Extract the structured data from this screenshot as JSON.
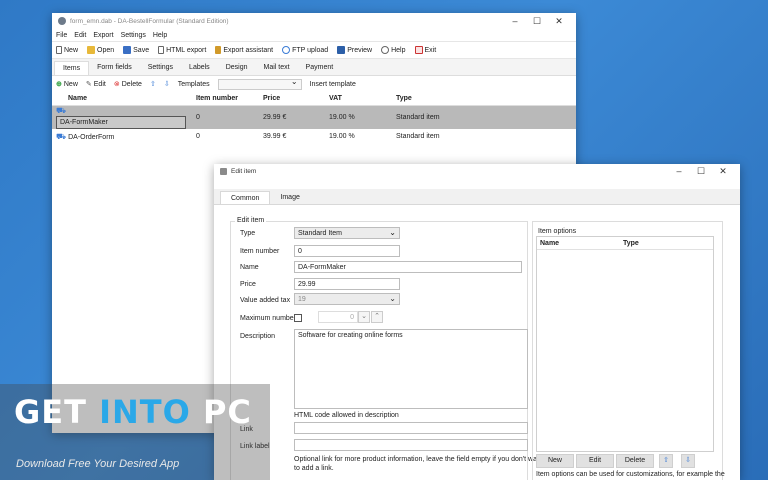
{
  "colors": {
    "accent": "#3a7bd5",
    "selected_row": "#b9b9b9",
    "desktop": "#2f79c6"
  },
  "main": {
    "title": "form_emn.dab - DA-BestellFormular (Standard Edition)",
    "menu": [
      "File",
      "Edit",
      "Export",
      "Settings",
      "Help"
    ],
    "toolbar": [
      {
        "label": "New",
        "icon": "new-file-icon"
      },
      {
        "label": "Open",
        "icon": "open-folder-icon"
      },
      {
        "label": "Save",
        "icon": "save-icon"
      },
      {
        "label": "HTML export",
        "icon": "html-export-icon"
      },
      {
        "label": "Export assistant",
        "icon": "wand-icon"
      },
      {
        "label": "FTP upload",
        "icon": "ftp-upload-icon"
      },
      {
        "label": "Preview",
        "icon": "preview-icon"
      },
      {
        "label": "Help",
        "icon": "help-icon"
      },
      {
        "label": "Exit",
        "icon": "exit-icon"
      }
    ],
    "tabs": [
      "Items",
      "Form fields",
      "Settings",
      "Labels",
      "Design",
      "Mail text",
      "Payment"
    ],
    "subbar": {
      "new": "New",
      "edit": "Edit",
      "delete": "Delete",
      "templates": "Templates",
      "insert": "Insert template"
    },
    "columns": [
      "Name",
      "Item number",
      "Price",
      "VAT",
      "Type"
    ],
    "rows": [
      {
        "name": "DA-FormMaker",
        "number": "0",
        "price": "29.99 €",
        "vat": "19.00 %",
        "type": "Standard item"
      },
      {
        "name": "DA-OrderForm",
        "number": "0",
        "price": "39.99 €",
        "vat": "19.00 %",
        "type": "Standard item"
      }
    ]
  },
  "dialog": {
    "title": "Edit item",
    "tabs": [
      "Common",
      "Image"
    ],
    "group_title": "Edit item",
    "labels": {
      "type": "Type",
      "item_number": "Item number",
      "name": "Name",
      "price": "Price",
      "vat": "Value added tax",
      "max_number": "Maximum number",
      "description": "Description",
      "link": "Link",
      "link_label": "Link label"
    },
    "values": {
      "type": "Standard Item",
      "item_number": "0",
      "name": "DA-FormMaker",
      "price": "29.99",
      "vat": "19",
      "max_number": "0",
      "description": "Software for creating online forms"
    },
    "html_note": "HTML code allowed in description",
    "link_note_1": "Optional link for more product information, leave the field empty if you don't want",
    "link_note_2": "to add a link.",
    "options": {
      "title": "Item options",
      "columns": [
        "Name",
        "Type"
      ],
      "buttons": [
        "New",
        "Edit",
        "Delete"
      ],
      "note": "Item options can be used for customizations, for example the"
    }
  },
  "watermark": {
    "get": "GET ",
    "into": "INTO",
    "pc": " PC",
    "sub": "Download Free Your Desired App"
  }
}
